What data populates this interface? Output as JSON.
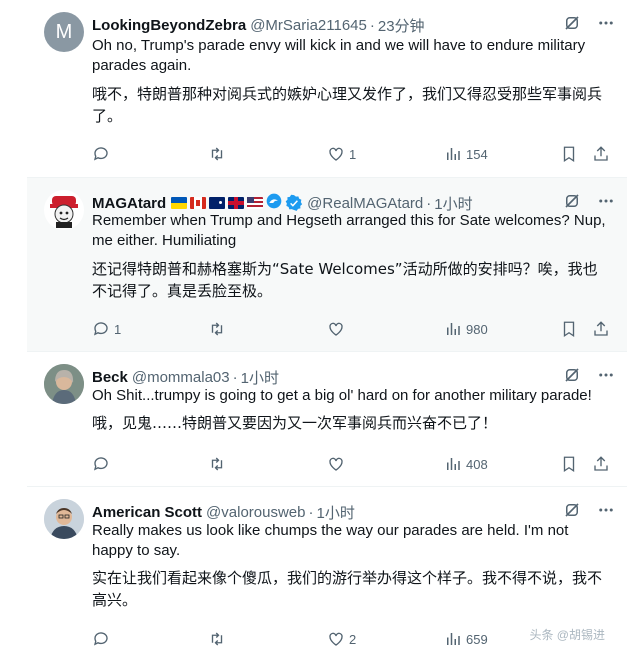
{
  "colors": {
    "verified": "#1d9bf0",
    "text_secondary": "#536471"
  },
  "tweets": [
    {
      "name": "LookingBeyondZebra",
      "handle": "@MrSaria211645",
      "sep": "·",
      "time": "23分钟",
      "avatar_letter": "M",
      "text": "Oh no, Trump's parade envy will kick in and we will have to endure military parades again.",
      "translation": "哦不，特朗普那种对阅兵式的嫉妒心理又发作了，我们又得忍受那些军事阅兵了。",
      "replies": "",
      "retweets": "",
      "likes": "1",
      "views": "154"
    },
    {
      "name": "MAGAtard",
      "handle": "@RealMAGAtard",
      "sep": "·",
      "time": "1小时",
      "flags": [
        "ukraine",
        "canada",
        "australia",
        "uk",
        "usa"
      ],
      "text": "Remember when Trump and Hegseth arranged this for Sate welcomes? Nup, me either. Humiliating",
      "translation": "还记得特朗普和赫格塞斯为“Sate Welcomes”活动所做的安排吗？唉，我也不记得了。真是丢脸至极。",
      "replies": "1",
      "retweets": "",
      "likes": "",
      "views": "980"
    },
    {
      "name": "Beck",
      "handle": "@mommala03",
      "sep": "·",
      "time": "1小时",
      "text": "Oh Shit...trumpy is going to get a big ol' hard on for another military parade!",
      "translation": "哦，见鬼……特朗普又要因为又一次军事阅兵而兴奋不已了！",
      "replies": "",
      "retweets": "",
      "likes": "",
      "views": "408"
    },
    {
      "name": "American Scott",
      "handle": "@valorousweb",
      "sep": "·",
      "time": "1小时",
      "text": "Really makes us look like chumps the way our parades are held. I'm not happy to say.",
      "translation": "实在让我们看起来像个傻瓜，我们的游行举办得这个样子。我不得不说，我不高兴。",
      "replies": "",
      "retweets": "",
      "likes": "2",
      "views": "659"
    }
  ],
  "watermark": "头条 @胡锡进"
}
